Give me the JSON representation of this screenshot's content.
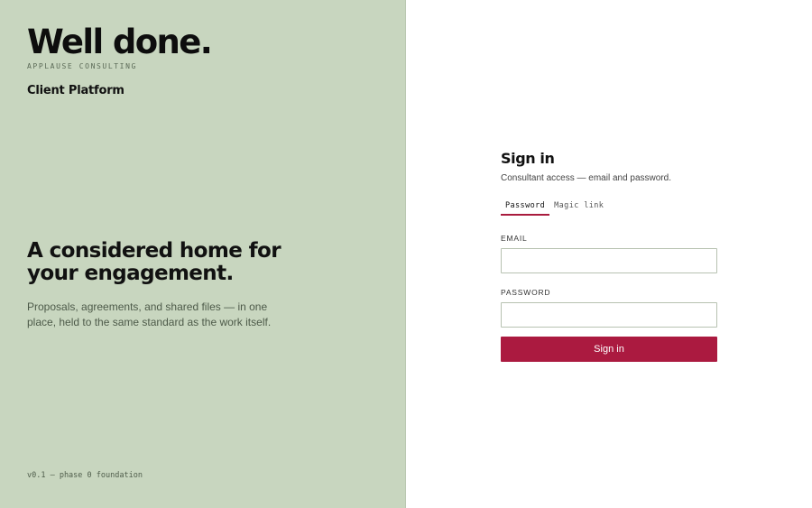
{
  "brand": {
    "logo_title": "Well done.",
    "logo_subtitle": "APPLAUSE CONSULTING",
    "platform_name": "Client Platform",
    "hero_heading": "A considered home for your engagement.",
    "hero_body": "Proposals, agreements, and shared files — in one place, held to the same standard as the work itself.",
    "version": "v0.1 — phase 0 foundation",
    "background_color": "#c8d6bf"
  },
  "signin": {
    "title": "Sign in",
    "subtitle": "Consultant access — email and password.",
    "tabs": [
      {
        "label": "Password",
        "active": true
      },
      {
        "label": "Magic link",
        "active": false
      }
    ],
    "email_label": "EMAIL",
    "email_value": "",
    "password_label": "PASSWORD",
    "password_value": "",
    "submit_label": "Sign in",
    "accent_color": "#ab1a40"
  }
}
